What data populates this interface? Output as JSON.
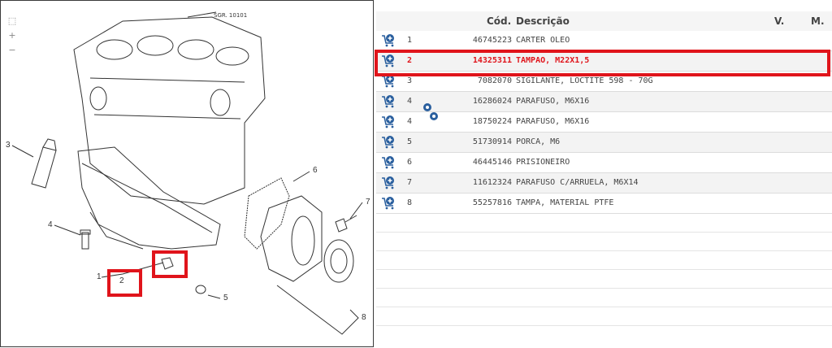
{
  "diagram": {
    "drawing_code": "SGR. 10101",
    "zoom_in_label": "+",
    "zoom_out_label": "−",
    "callouts": [
      "1",
      "2",
      "3",
      "4",
      "5",
      "6",
      "7",
      "8"
    ]
  },
  "table": {
    "headers": {
      "code": "Cód.",
      "description": "Descrição",
      "v": "V.",
      "m": "M."
    },
    "rows": [
      {
        "num": "1",
        "code": "46745223",
        "description": "CARTER OLEO"
      },
      {
        "num": "2",
        "code": "14325311",
        "description": "TAMPAO, M22X1,5"
      },
      {
        "num": "3",
        "code": "7082070",
        "description": "SIGILANTE, LOCTITE 598 - 70G"
      },
      {
        "num": "4",
        "code": "16286024",
        "description": "PARAFUSO, M6X16"
      },
      {
        "num": "4",
        "code": "18750224",
        "description": "PARAFUSO, M6X16"
      },
      {
        "num": "5",
        "code": "51730914",
        "description": "PORCA, M6"
      },
      {
        "num": "6",
        "code": "46445146",
        "description": "PRISIONEIRO"
      },
      {
        "num": "7",
        "code": "11612324",
        "description": "PARAFUSO C/ARRUELA, M6X14"
      },
      {
        "num": "8",
        "code": "55257816",
        "description": "TAMPA, MATERIAL PTFE"
      }
    ],
    "selected_row": 1,
    "empty_rows": 6
  },
  "colors": {
    "highlight": "#e0141b",
    "cart_icon": "#2a5f9e",
    "row_alt": "#f3f3f3"
  },
  "icons": {
    "add_to_cart": "cart-plus-icon",
    "alternatives": "gears-icon"
  }
}
